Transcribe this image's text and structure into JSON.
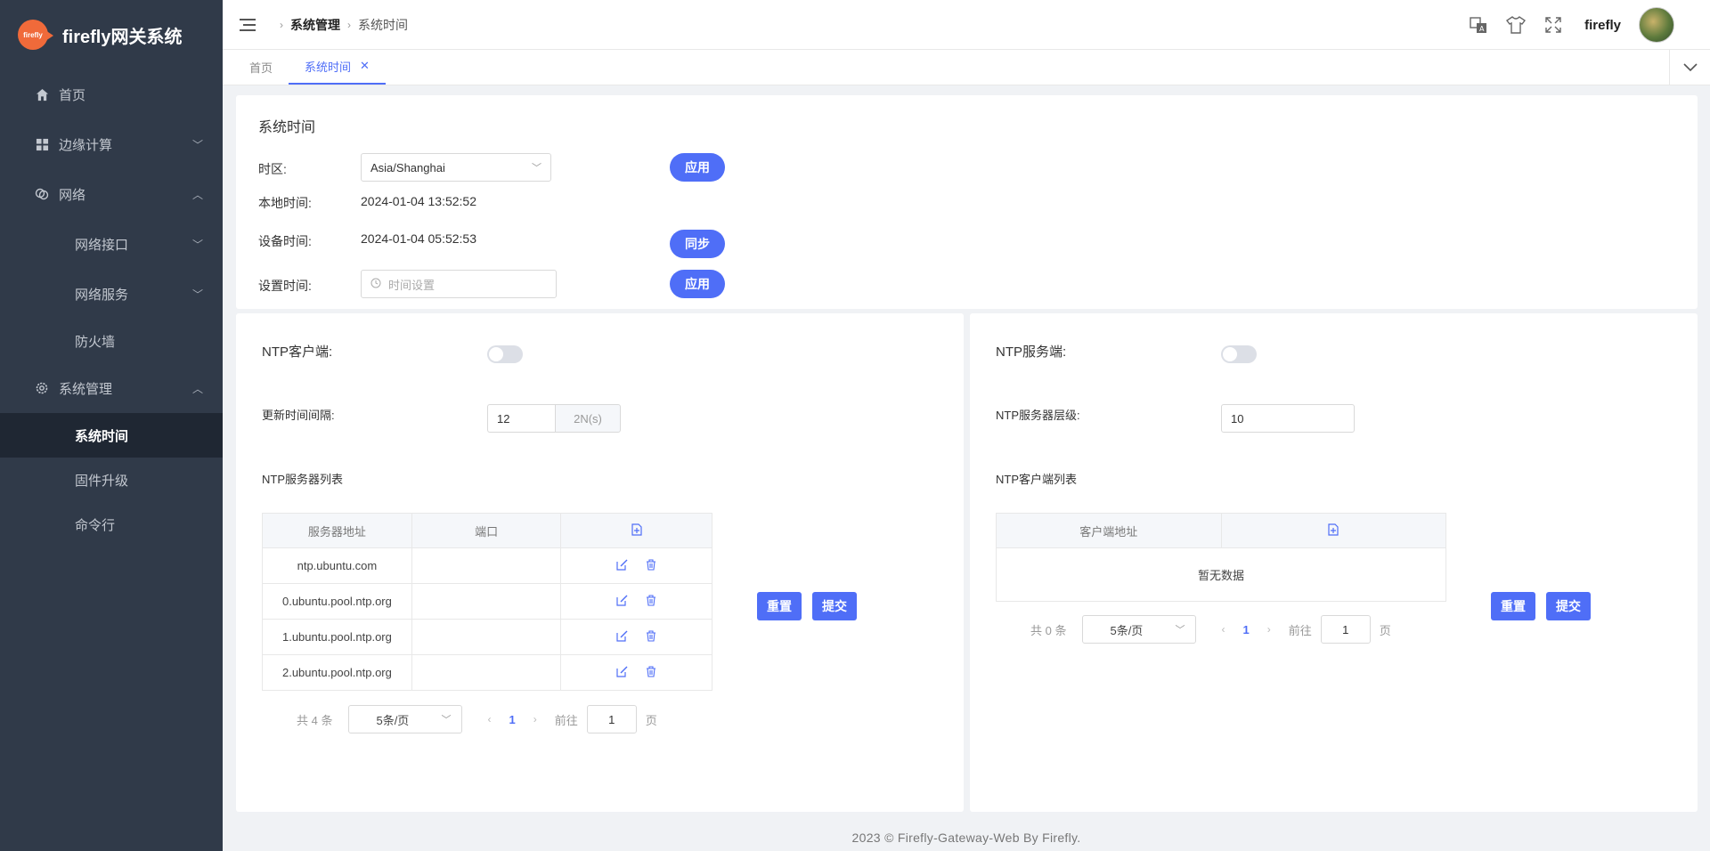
{
  "app": {
    "title": "firefly网关系统",
    "logo_text": "firefly"
  },
  "sidebar": {
    "items": [
      {
        "label": "首页",
        "icon": "home-icon"
      },
      {
        "label": "边缘计算",
        "icon": "grid-icon"
      },
      {
        "label": "网络",
        "icon": "link-icon"
      },
      {
        "label": "网络接口"
      },
      {
        "label": "网络服务"
      },
      {
        "label": "防火墙"
      },
      {
        "label": "系统管理",
        "icon": "gear-icon"
      },
      {
        "label": "系统时间"
      },
      {
        "label": "固件升级"
      },
      {
        "label": "命令行"
      }
    ]
  },
  "header": {
    "breadcrumb": [
      "系统管理",
      "系统时间"
    ],
    "username": "firefly"
  },
  "tabs": [
    {
      "label": "首页"
    },
    {
      "label": "系统时间"
    }
  ],
  "system_time": {
    "title": "系统时间",
    "timezone_label": "时区:",
    "timezone_value": "Asia/Shanghai",
    "apply_label": "应用",
    "local_time_label": "本地时间:",
    "local_time_value": "2024-01-04 13:52:52",
    "device_time_label": "设备时间:",
    "device_time_value": "2024-01-04 05:52:53",
    "sync_label": "同步",
    "set_time_label": "设置时间:",
    "set_time_placeholder": "时间设置",
    "apply2_label": "应用"
  },
  "ntp_client": {
    "title": "NTP客户端:",
    "interval_label": "更新时间间隔:",
    "interval_value": "12",
    "interval_unit": "2N(s)",
    "list_title": "NTP服务器列表",
    "columns": [
      "服务器地址",
      "端口"
    ],
    "rows": [
      {
        "addr": "ntp.ubuntu.com",
        "port": ""
      },
      {
        "addr": "0.ubuntu.pool.ntp.org",
        "port": ""
      },
      {
        "addr": "1.ubuntu.pool.ntp.org",
        "port": ""
      },
      {
        "addr": "2.ubuntu.pool.ntp.org",
        "port": ""
      }
    ],
    "pager": {
      "total": "共 4 条",
      "page_size": "5条/页",
      "page": "1",
      "goto_prefix": "前往",
      "goto_value": "1",
      "goto_suffix": "页"
    },
    "reset_label": "重置",
    "submit_label": "提交"
  },
  "ntp_server": {
    "title": "NTP服务端:",
    "stratum_label": "NTP服务器层级:",
    "stratum_value": "10",
    "list_title": "NTP客户端列表",
    "columns": [
      "客户端地址"
    ],
    "empty_text": "暂无数据",
    "pager": {
      "total": "共 0 条",
      "page_size": "5条/页",
      "page": "1",
      "goto_prefix": "前往",
      "goto_value": "1",
      "goto_suffix": "页"
    },
    "reset_label": "重置",
    "submit_label": "提交"
  },
  "footer": {
    "text": "2023 © Firefly-Gateway-Web By Firefly."
  },
  "colors": {
    "accent": "#4f6ef7",
    "sidebar_bg": "#303a49",
    "sidebar_active_bg": "#1f2733"
  }
}
